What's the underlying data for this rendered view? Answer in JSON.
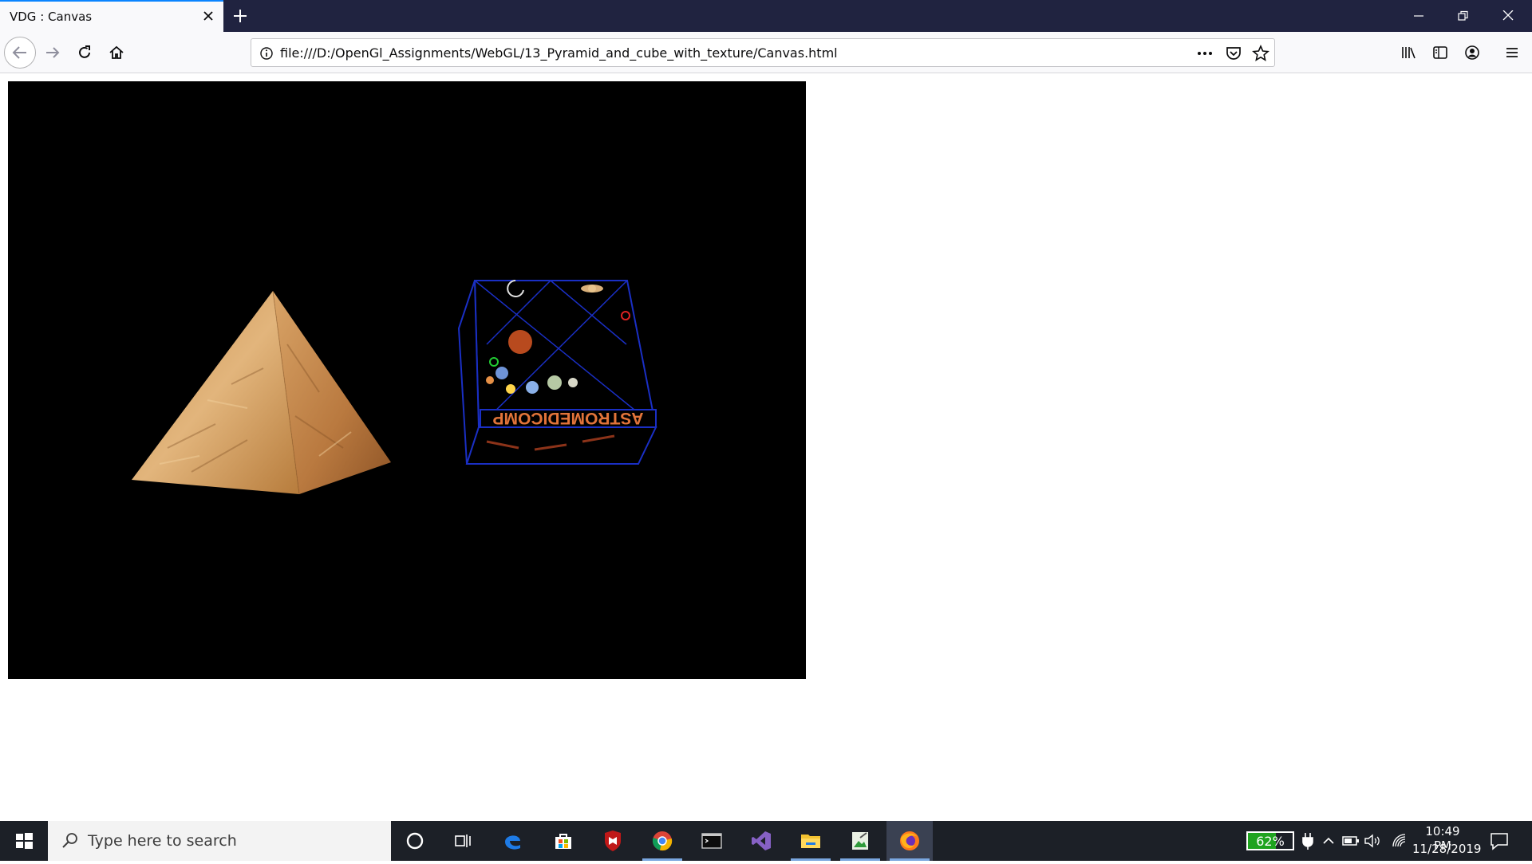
{
  "browser": {
    "tab_title": "VDG : Canvas",
    "url": "file:///D:/OpenGl_Assignments/WebGL/13_Pyramid_and_cube_with_texture/Canvas.html"
  },
  "canvas": {
    "background": "#000000",
    "cube_banner": "ASTROMEDICOMP"
  },
  "taskbar": {
    "search_placeholder": "Type here to search",
    "battery_percent": "62%",
    "battery_level": 0.62,
    "time": "10:49 PM",
    "date": "11/28/2019"
  },
  "colors": {
    "tab_strip": "#202340",
    "accent": "#0a84ff",
    "taskbar": "#1c2027",
    "battery_green": "#1fa31f"
  }
}
